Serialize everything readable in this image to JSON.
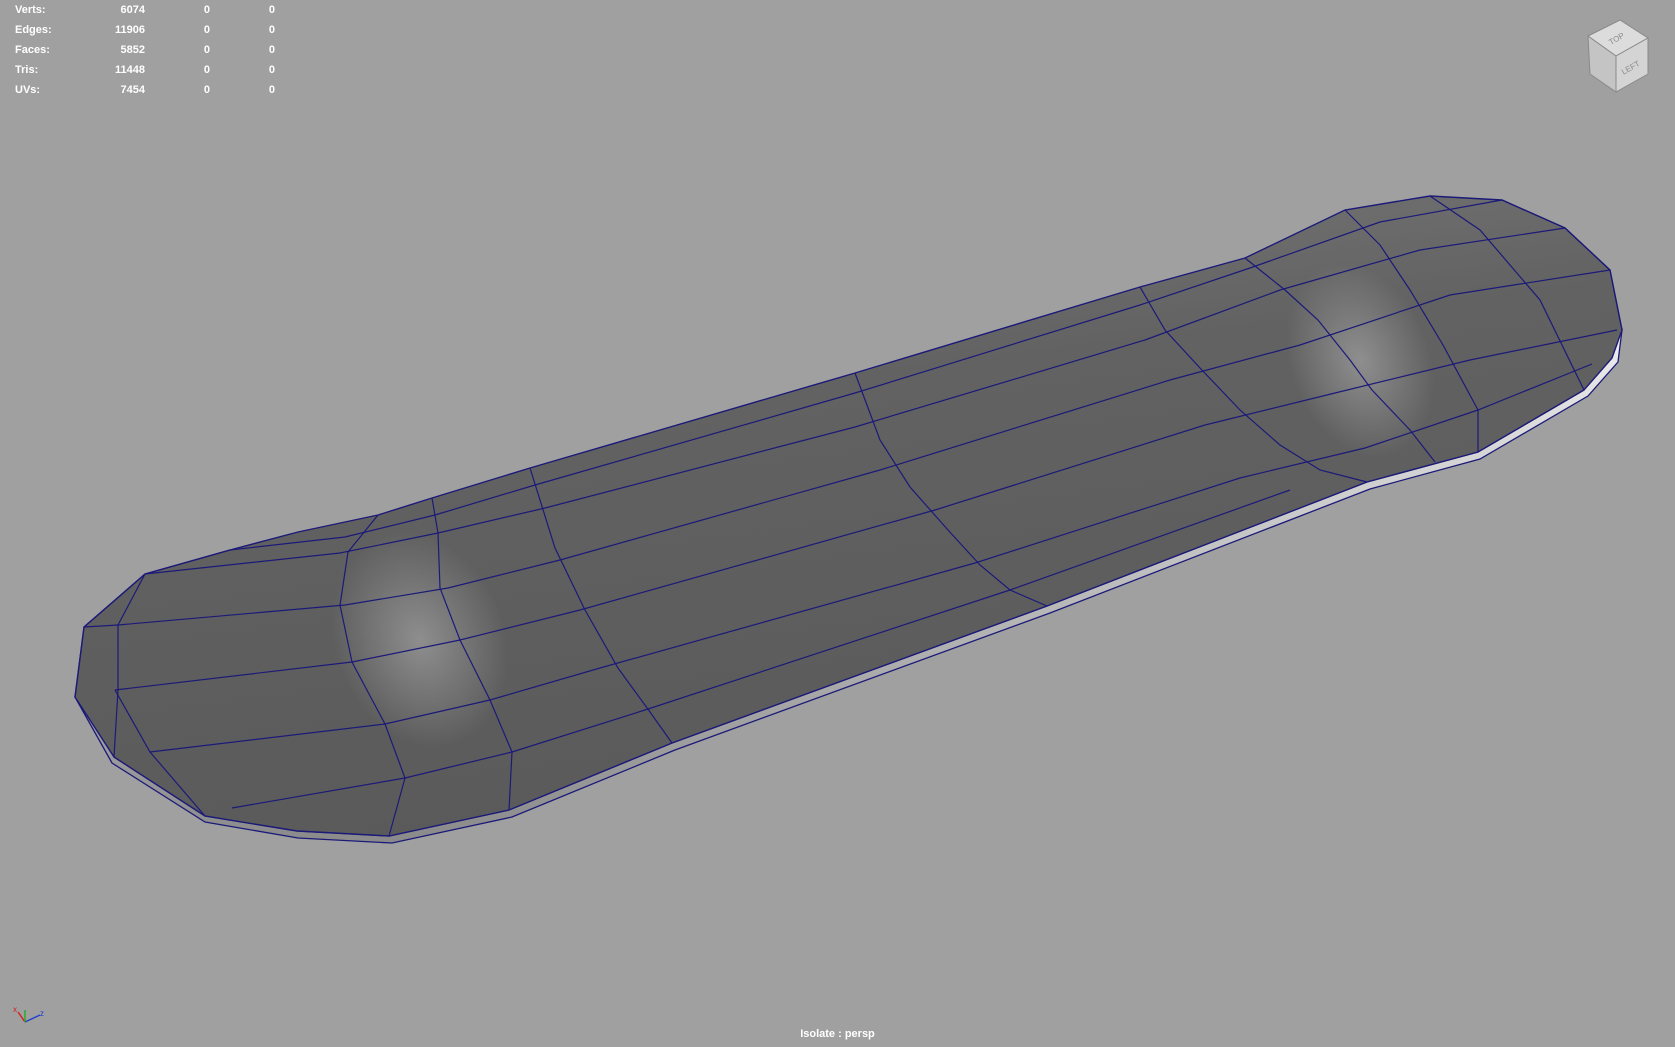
{
  "hud": {
    "rows": [
      {
        "label": "Verts:",
        "v1": "6074",
        "v2": "0",
        "v3": "0"
      },
      {
        "label": "Edges:",
        "v1": "11906",
        "v2": "0",
        "v3": "0"
      },
      {
        "label": "Faces:",
        "v1": "5852",
        "v2": "0",
        "v3": "0"
      },
      {
        "label": "Tris:",
        "v1": "11448",
        "v2": "0",
        "v3": "0"
      },
      {
        "label": "UVs:",
        "v1": "7454",
        "v2": "0",
        "v3": "0"
      }
    ]
  },
  "viewcube": {
    "top_label": "TOP",
    "left_label": "LEFT"
  },
  "axis": {
    "x_label": "x",
    "z_label": "z"
  },
  "status": {
    "text": "Isolate : persp"
  },
  "colors": {
    "background": "#a0a0a0",
    "wireframe": "#1c1a78",
    "mesh_fill": "#6a6a6a"
  }
}
